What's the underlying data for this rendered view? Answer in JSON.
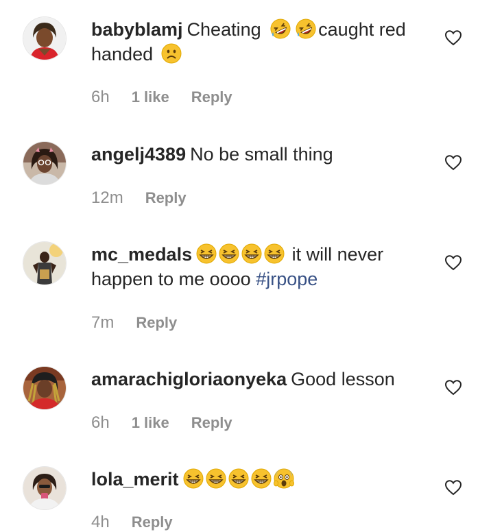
{
  "comments": [
    {
      "username": "babyblamj",
      "text_parts": [
        "Cheating",
        "caught red",
        "handed"
      ],
      "emojis": [
        "rofl-face",
        "rofl-face",
        "frowning-face"
      ],
      "time": "6h",
      "likes": "1 like",
      "reply": "Reply"
    },
    {
      "username": "angelj4389",
      "text": "No be small thing",
      "time": "12m",
      "reply": "Reply"
    },
    {
      "username": "mc_medals",
      "emojis": [
        "grinning-squinting-face",
        "grinning-squinting-face",
        "grinning-squinting-face",
        "grinning-squinting-face"
      ],
      "text_parts": [
        "it will never",
        "happen to me oooo"
      ],
      "hashtag": "#jrpope",
      "time": "7m",
      "reply": "Reply"
    },
    {
      "username": "amarachigloriaonyeka",
      "text": "Good lesson",
      "time": "6h",
      "likes": "1 like",
      "reply": "Reply"
    },
    {
      "username": "lola_merit",
      "emojis": [
        "grinning-squinting-face",
        "grinning-squinting-face",
        "grinning-squinting-face",
        "grinning-squinting-face",
        "screaming-face"
      ],
      "time": "4h",
      "reply": "Reply"
    }
  ],
  "colors": {
    "text": "#262626",
    "meta": "#8e8e8e",
    "hashtag": "#385185",
    "emoji": "#f7c22e"
  },
  "icons": [
    "heart-outline-icon"
  ]
}
